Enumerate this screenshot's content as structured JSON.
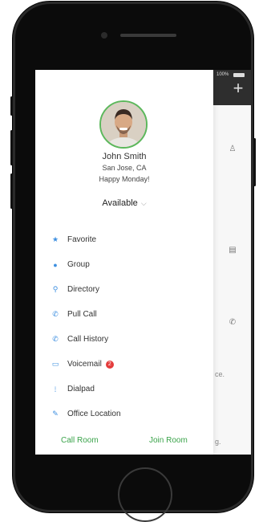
{
  "status_bar": {
    "battery": "100%"
  },
  "profile": {
    "name": "John Smith",
    "location": "San Jose, CA",
    "message": "Happy Monday!",
    "presence": "Available"
  },
  "menu": {
    "items": [
      {
        "label": "Favorite",
        "icon": "star-icon"
      },
      {
        "label": "Group",
        "icon": "group-icon"
      },
      {
        "label": "Directory",
        "icon": "search-icon"
      },
      {
        "label": "Pull Call",
        "icon": "phone-icon"
      },
      {
        "label": "Call History",
        "icon": "phone-icon"
      },
      {
        "label": "Voicemail",
        "icon": "voicemail-icon",
        "badge": "2"
      },
      {
        "label": "Dialpad",
        "icon": "dialpad-icon"
      },
      {
        "label": "Office Location",
        "icon": "location-icon"
      }
    ]
  },
  "footer": {
    "call_room": "Call Room",
    "join_room": "Join Room"
  },
  "background": {
    "text1": "ce.",
    "text2": "g."
  },
  "colors": {
    "accent_green": "#3aa34a",
    "icon_blue": "#3d8fe0",
    "badge_red": "#e43b3b"
  }
}
